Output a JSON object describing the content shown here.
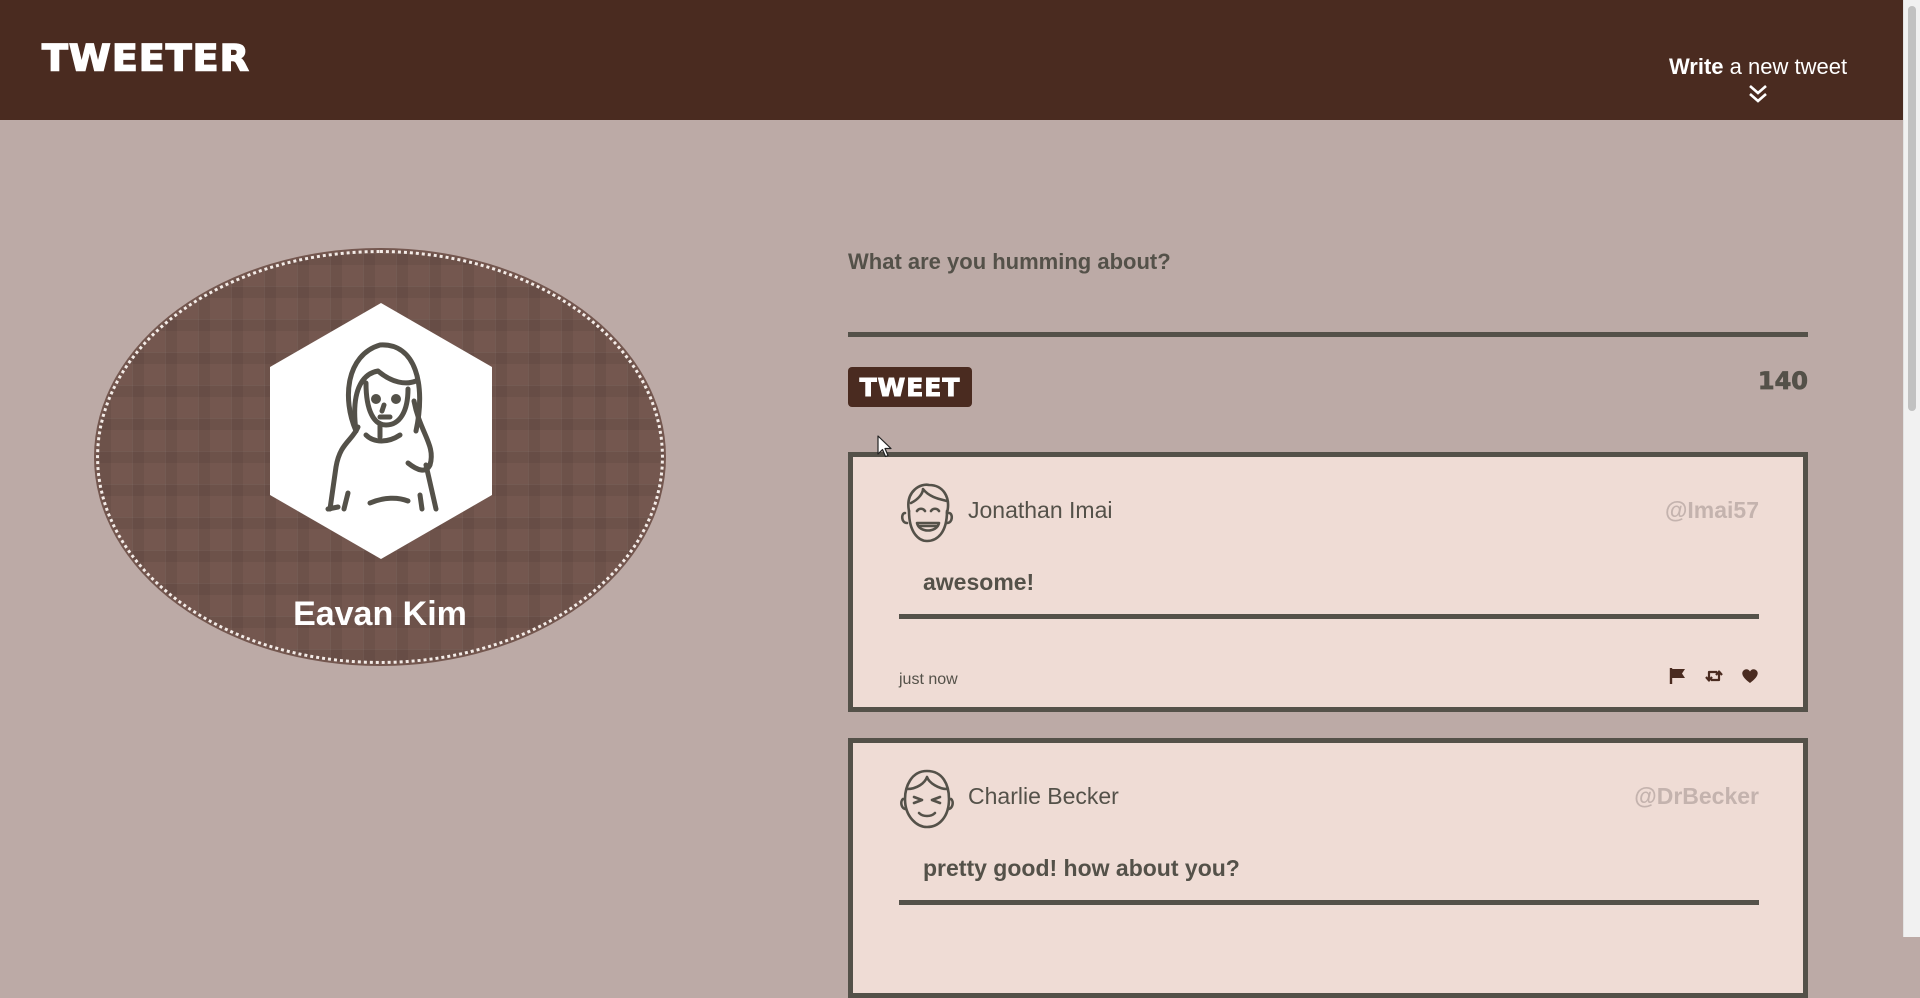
{
  "nav": {
    "logo": "TWEETER",
    "write_bold": "Write",
    "write_rest": " a new tweet",
    "write_icon": "double-chevron-down-icon"
  },
  "profile": {
    "name": "Eavan Kim",
    "avatar_icon": "woman-avatar-icon"
  },
  "compose": {
    "placeholder": "What are you humming about?",
    "button_label": "TWEET",
    "counter": "140"
  },
  "tweets": [
    {
      "name": "Jonathan Imai",
      "handle": "@Imai57",
      "body": "awesome!",
      "time": "just now",
      "avatar_icon": "laughing-man-avatar-icon"
    },
    {
      "name": "Charlie Becker",
      "handle": "@DrBecker",
      "body": "pretty good! how about you?",
      "avatar_icon": "smiling-man-avatar-icon"
    }
  ],
  "actions": [
    "flag-icon",
    "retweet-icon",
    "heart-icon"
  ],
  "colors": {
    "nav_bg": "#4a2b20",
    "page_bg": "#bcaaa6",
    "card_bg": "#efdcd5",
    "ink": "#545149",
    "handle": "#c4b3ae"
  }
}
